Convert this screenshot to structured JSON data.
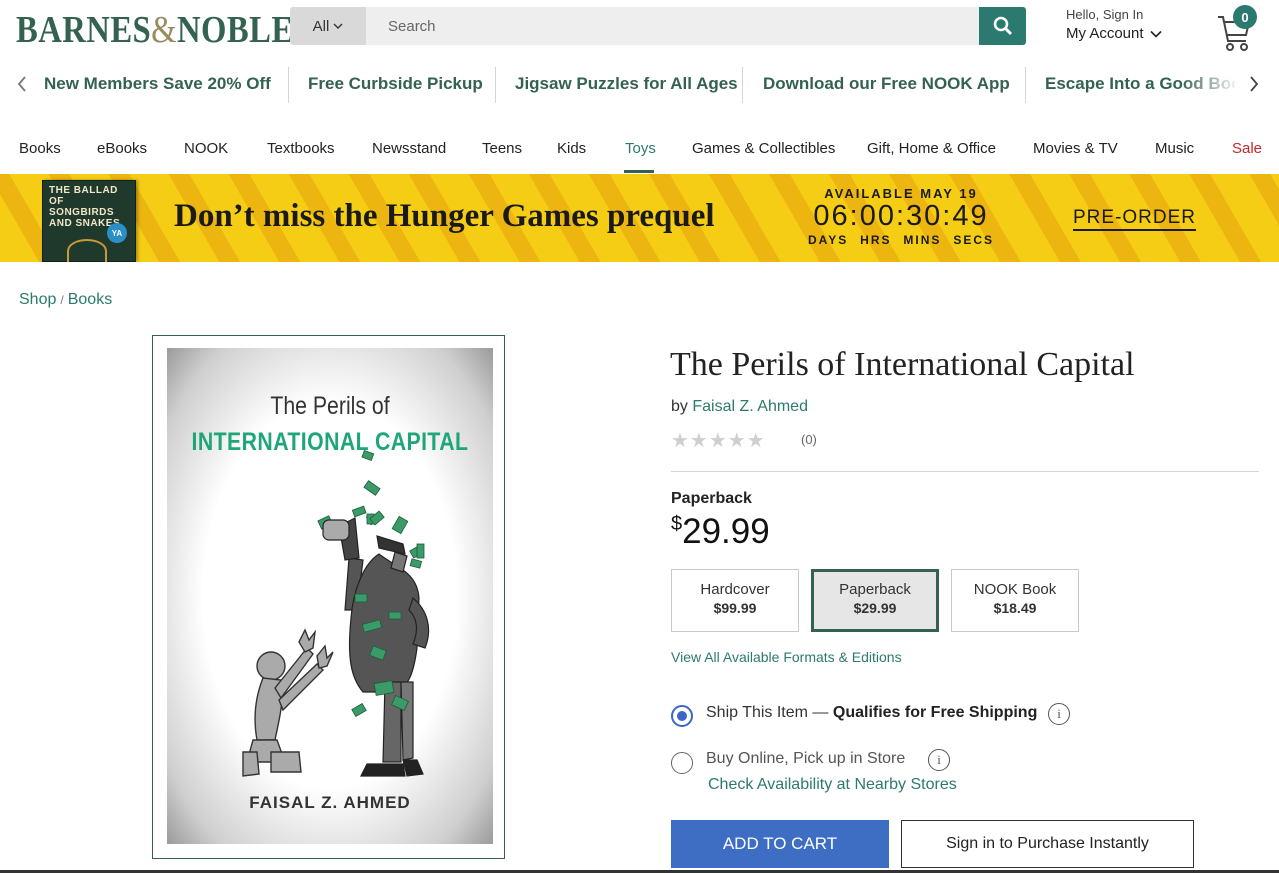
{
  "header": {
    "logo_main": "BARNES",
    "logo_amp": "&",
    "logo_end": "NOBLE",
    "search_category": "All",
    "search_placeholder": "Search",
    "account_greeting": "Hello, Sign In",
    "account_label": "My Account",
    "cart_count": "0"
  },
  "promo": {
    "items": [
      "New Members Save 20% Off",
      "Free Curbside Pickup",
      "Jigsaw Puzzles for All Ages",
      "Download our Free NOOK App",
      "Escape Into a Good Book"
    ]
  },
  "nav": {
    "items": [
      "Books",
      "eBooks",
      "NOOK",
      "Textbooks",
      "Newsstand",
      "Teens",
      "Kids",
      "Toys",
      "Games & Collectibles",
      "Gift, Home & Office",
      "Movies & TV",
      "Music",
      "Sale"
    ],
    "active": "Toys"
  },
  "banner": {
    "book_title": "THE BALLAD OF SONGBIRDS AND SNAKES",
    "book_badge": "YA",
    "headline": "Don’t miss the Hunger Games prequel",
    "available": "AVAILABLE MAY 19",
    "countdown": "06:00:30:49",
    "labels": [
      "DAYS",
      "HRS",
      "MINS",
      "SECS"
    ],
    "cta": "PRE-ORDER"
  },
  "breadcrumb": {
    "shop": "Shop",
    "sep": "/",
    "books": "Books"
  },
  "cover": {
    "line1": "The Perils of",
    "line2": "INTERNATIONAL CAPITAL",
    "author": "FAISAL Z. AHMED"
  },
  "product": {
    "title": "The Perils of International Capital",
    "by": "by",
    "author": "Faisal Z. Ahmed",
    "stars": "★★★★★",
    "rating_count": "(0)",
    "format_label": "Paperback",
    "price_symbol": "$",
    "price": "29.99",
    "formats": [
      {
        "name": "Hardcover",
        "price": "$99.99"
      },
      {
        "name": "Paperback",
        "price": "$29.99"
      },
      {
        "name": "NOOK Book",
        "price": "$18.49"
      }
    ],
    "view_all": "View All Available Formats & Editions",
    "ship_prefix": "Ship This Item —",
    "ship_bold": "Qualifies for Free Shipping",
    "pickup": "Buy Online, Pick up in Store",
    "check_availability": "Check Availability at Nearby Stores",
    "add_to_cart": "ADD TO CART",
    "sign_in_purchase": "Sign in to Purchase Instantly"
  },
  "colors": {
    "brand_green": "#346250",
    "link_teal": "#2c7a6f",
    "cart_blue": "#3e6dc4",
    "banner_yellow": "#f6cd15",
    "sale_red": "#c62828"
  }
}
